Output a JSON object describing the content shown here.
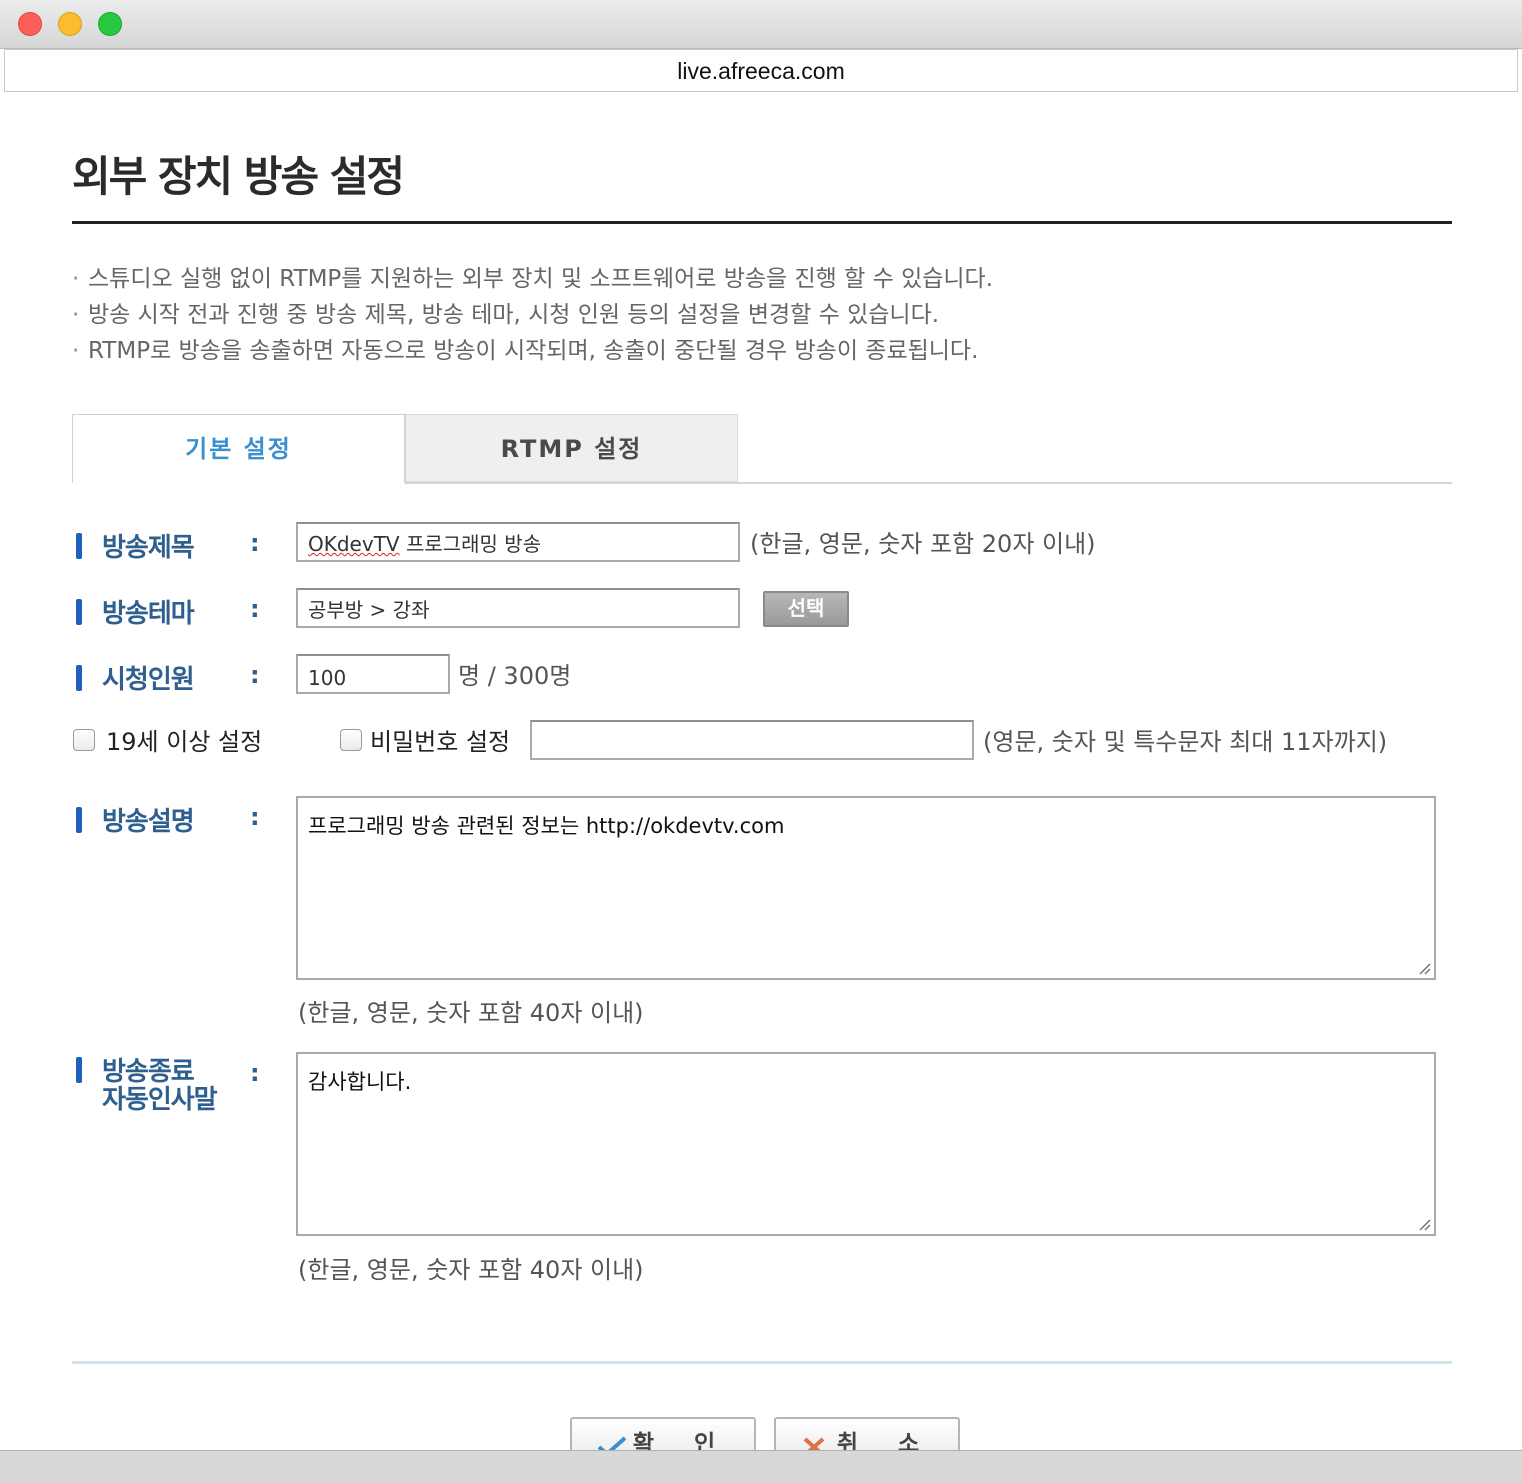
{
  "window": {
    "url": "live.afreeca.com"
  },
  "page": {
    "title": "외부 장치 방송 설정",
    "notes": [
      "스튜디오 실행 없이 RTMP를 지원하는 외부 장치 및 소프트웨어로 방송을 진행 할 수 있습니다.",
      "방송 시작 전과 진행 중 방송 제목, 방송 테마, 시청 인원 등의 설정을 변경할 수 있습니다.",
      "RTMP로 방송을 송출하면 자동으로 방송이 시작되며, 송출이 중단될 경우 방송이 종료됩니다."
    ],
    "note_bullet": "·",
    "colon": ":"
  },
  "tabs": [
    {
      "label": "기본 설정",
      "active": true
    },
    {
      "label": "RTMP 설정",
      "active": false
    }
  ],
  "form": {
    "title": {
      "label": "방송제목",
      "value_underlined": "OKdevTV",
      "value_rest": " 프로그래밍 방송",
      "hint": "(한글, 영문, 숫자 포함 20자 이내)"
    },
    "theme": {
      "label": "방송테마",
      "value": "공부방 > 강좌",
      "select_button": "선택"
    },
    "viewers": {
      "label": "시청인원",
      "value": "100",
      "suffix": "명 / 300명"
    },
    "adult": {
      "label": "19세 이상 설정",
      "checked": false
    },
    "password": {
      "label": "비밀번호 설정",
      "checked": false,
      "value": "",
      "hint": "(영문, 숫자 및 특수문자 최대 11자까지)"
    },
    "description": {
      "label": "방송설명",
      "value": "프로그래밍 방송 관련된 정보는 http://okdevtv.com",
      "hint": "(한글, 영문, 숫자 포함 40자 이내)"
    },
    "farewell": {
      "label_line1": "방송종료",
      "label_line2": "자동인사말",
      "value": "감사합니다.",
      "hint": "(한글, 영문, 숫자 포함 40자 이내)"
    }
  },
  "actions": {
    "confirm": "확 인",
    "cancel": "취 소"
  },
  "colors": {
    "accent": "#3a8fd0",
    "label": "#2f5f8f",
    "label_bar": "#1f5fbf"
  }
}
